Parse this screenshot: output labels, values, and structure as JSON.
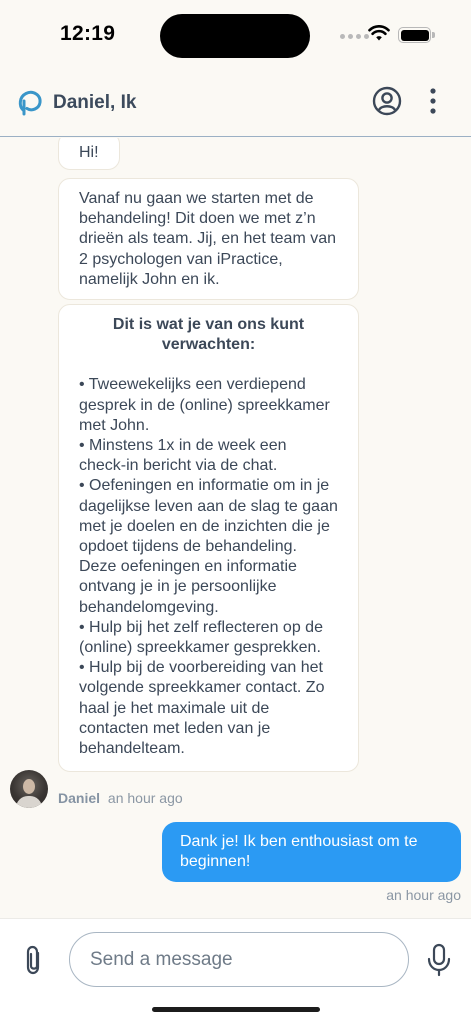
{
  "status_bar": {
    "time": "12:19"
  },
  "header": {
    "title": "Daniel, Ik"
  },
  "messages": [
    {
      "text": "Hi!"
    },
    {
      "text": "Vanaf nu gaan we starten met de behandeling! Dit doen we met z’n drieën als team. Jij, en het team van 2 psychologen van iPractice, namelijk John en ik."
    },
    {
      "heading": "Dit is wat je van ons kunt verwachten:",
      "bullets": [
        "• Tweewekelijks een verdiepend gesprek in de (online) spreekkamer met John.",
        "• Minstens 1x in de week een check-in bericht via de chat.",
        "• Oefeningen en informatie om in je dagelijkse leven aan de slag te gaan met je doelen en de inzichten die je opdoet tijdens de behandeling. Deze oefeningen en informatie ontvang je in je persoonlijke behandelomgeving.",
        "• Hulp bij het zelf reflecteren op de (online) spreekkamer gesprekken.",
        "• Hulp bij de voorbereiding van het volgende spreekkamer contact. Zo haal je het maximale uit de contacten met leden van je behandelteam."
      ]
    }
  ],
  "incoming_meta": {
    "sender": "Daniel",
    "time": "an hour ago"
  },
  "outgoing": {
    "text": "Dank je! Ik ben enthousiast om te beginnen!",
    "time": "an hour ago"
  },
  "composer": {
    "placeholder": "Send a message"
  },
  "colors": {
    "accent": "#2b9af3",
    "background": "#fbf9f4",
    "header_text": "#3c4a5c"
  },
  "icons": [
    "logo-icon",
    "profile-icon",
    "more-icon",
    "paperclip-icon",
    "microphone-icon"
  ]
}
